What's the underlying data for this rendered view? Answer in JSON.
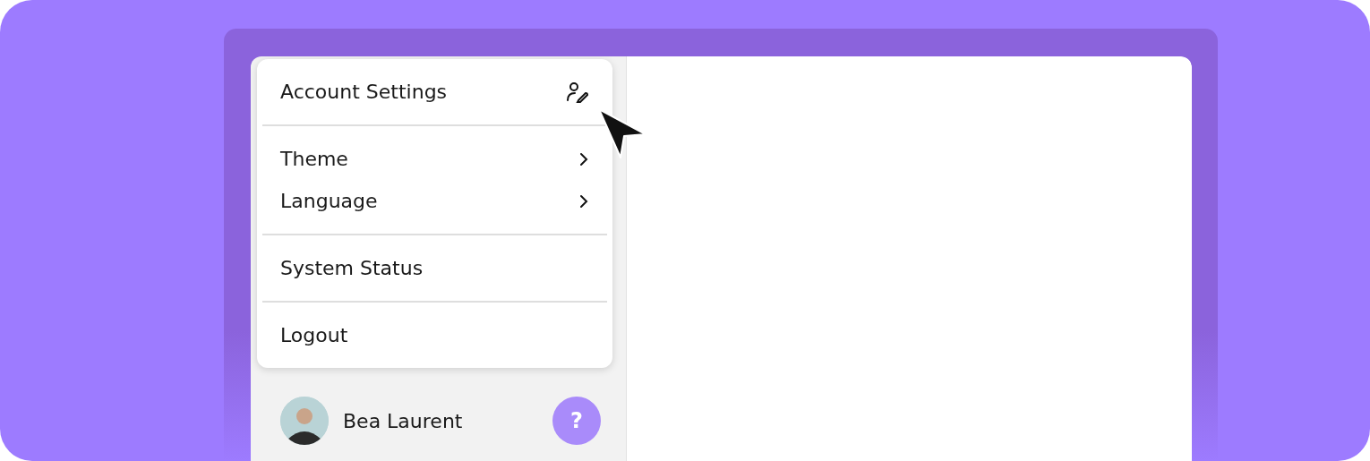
{
  "menu": {
    "groups": [
      [
        {
          "kind": "icon",
          "label": "Account Settings"
        }
      ],
      [
        {
          "kind": "submenu",
          "label": "Theme"
        },
        {
          "kind": "submenu",
          "label": "Language"
        }
      ],
      [
        {
          "kind": "plain",
          "label": "System Status"
        }
      ],
      [
        {
          "kind": "plain",
          "label": "Logout"
        }
      ]
    ]
  },
  "user": {
    "name": "Bea Laurent"
  },
  "help_button": {
    "label": "?"
  }
}
